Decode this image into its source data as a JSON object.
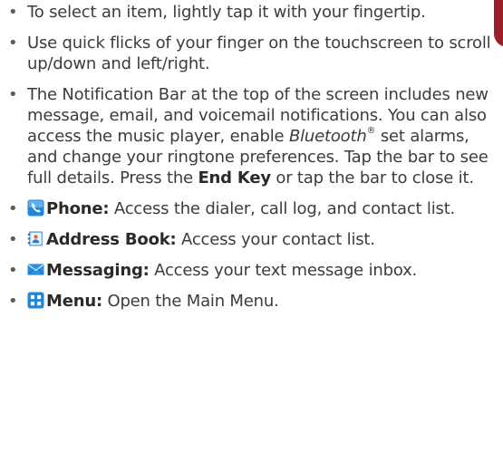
{
  "bullets": [
    {
      "text": "To select an item, lightly tap it with your fingertip."
    },
    {
      "text": "Use quick flicks of your finger on the touchscreen to scroll up/down and left/right."
    },
    {
      "part1": "The Notification Bar at the top of the screen includes new message, email, and voicemail notifications. You can also access the music player, enable ",
      "bluetooth": "Bluetooth",
      "registered": "®",
      "part2": " set alarms, and change your ringtone preferences. Tap the bar to see full details. Press the ",
      "end_key": "End Key",
      "part3": " or tap the bar to close it."
    },
    {
      "icon": "phone-icon",
      "label": "Phone:",
      "text": " Access the dialer, call log, and contact list."
    },
    {
      "icon": "address-book-icon",
      "label": "Address Book:",
      "text": " Access your contact list."
    },
    {
      "icon": "envelope-icon",
      "label": "Messaging:",
      "text": " Access your text message inbox."
    },
    {
      "icon": "grid-menu-icon",
      "label": "Menu:",
      "text": " Open the Main Menu."
    }
  ],
  "bullet_glyph": "•",
  "colors": {
    "text": "#3c3c3c",
    "icon_blue": "#1f86d9",
    "accent_red": "#9a1f2b"
  }
}
